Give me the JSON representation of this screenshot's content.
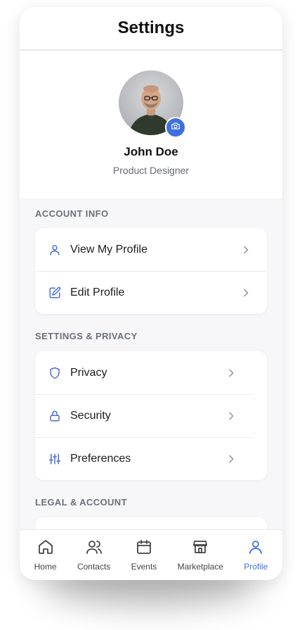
{
  "header": {
    "title": "Settings"
  },
  "profile": {
    "name": "John Doe",
    "role": "Product Designer"
  },
  "sections": [
    {
      "title": "ACCOUNT INFO",
      "items": [
        {
          "label": "View My Profile",
          "icon": "user-icon"
        },
        {
          "label": "Edit Profile",
          "icon": "edit-icon"
        }
      ]
    },
    {
      "title": "SETTINGS & PRIVACY",
      "items": [
        {
          "label": "Privacy",
          "icon": "shield-icon"
        },
        {
          "label": "Security",
          "icon": "lock-icon"
        },
        {
          "label": "Preferences",
          "icon": "sliders-icon"
        }
      ]
    },
    {
      "title": "LEGAL & ACCOUNT",
      "items": []
    }
  ],
  "tabs": [
    {
      "label": "Home",
      "icon": "home-icon",
      "active": false
    },
    {
      "label": "Contacts",
      "icon": "contacts-icon",
      "active": false
    },
    {
      "label": "Events",
      "icon": "calendar-icon",
      "active": false
    },
    {
      "label": "Marketplace",
      "icon": "store-icon",
      "active": false
    },
    {
      "label": "Profile",
      "icon": "user-icon",
      "active": true
    }
  ],
  "colors": {
    "accent": "#3f6fe0",
    "icon_blue": "#4a6fd6"
  }
}
